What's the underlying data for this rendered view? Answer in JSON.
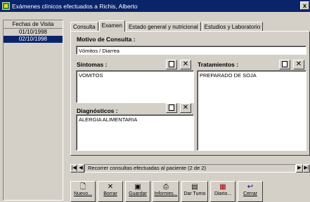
{
  "window": {
    "title": "Exámenes clínicos efectuados a Richis, Alberto",
    "close": "x"
  },
  "dates": {
    "header": "Fechas de Visita",
    "items": [
      "01/10/1998",
      "02/10/1998"
    ],
    "selected": 1
  },
  "tabs": [
    "Consulta",
    "Examen",
    "Estado general y nutricional",
    "Estudios y Laboratorio"
  ],
  "active_tab": 1,
  "form": {
    "motivo_label": "Motivo de Consulta :",
    "motivo_value": "Vómitos / Diarrea",
    "sintomas_label": "Síntomas :",
    "sintomas_value": "VOMITOS",
    "tratamientos_label": "Tratamientos :",
    "tratamientos_value": "PREPARADO DE SOJA",
    "diagnosticos_label": "Diagnósticos :",
    "diagnosticos_value": "ALERGIA ALIMENTARIA"
  },
  "nav": {
    "first": "|◀",
    "prev": "◀",
    "next": "▶",
    "last": "▶|",
    "text": "Recorrer consultas efectuadas al paciente (2 de 2)"
  },
  "toolbar": {
    "nuevo": "Nuevo...",
    "borrar": "Borrar",
    "guardar": "Guardar",
    "informes": "Informes...",
    "dar_turno": "Dar Turno",
    "diario": "Diario...",
    "cerrar": "Cerrar"
  },
  "icons": {
    "nuevo": "document-icon",
    "borrar": "x-icon",
    "guardar": "floppy-icon",
    "informes": "printer-icon",
    "dar_turno": "clipboard-icon",
    "diario": "calendar-icon",
    "cerrar": "exit-icon"
  },
  "colors": {
    "titlebar": "#0a246a",
    "selection": "#0a246a",
    "face": "#d4d0c8"
  }
}
